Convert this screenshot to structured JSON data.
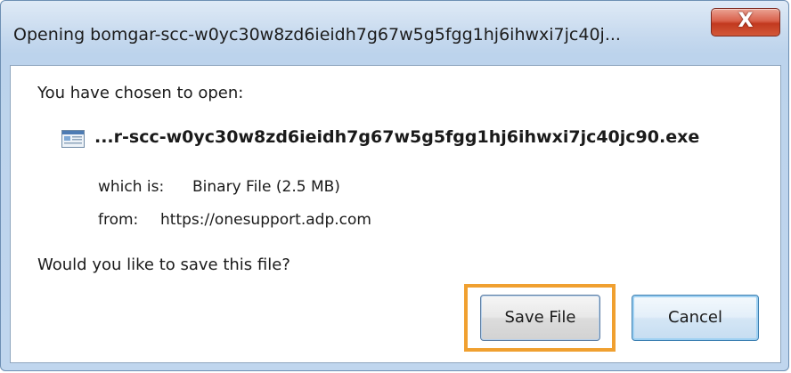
{
  "window": {
    "title": "Opening bomgar-scc-w0yc30w8zd6ieidh7g67w5g5fgg1hj6ihwxi7jc40j...",
    "close_glyph": "X"
  },
  "dialog": {
    "prompt": "You have chosen to open:",
    "file_icon": "exe-file-icon",
    "file_name": "...r-scc-w0yc30w8zd6ieidh7g67w5g5fgg1hj6ihwxi7jc40jc90.exe",
    "which_is_label": "which is:",
    "which_is_value": "Binary File (2.5 MB)",
    "from_label": "from:",
    "from_value": "https://onesupport.adp.com",
    "question": "Would you like to save this file?"
  },
  "buttons": {
    "save_label": "Save File",
    "cancel_label": "Cancel"
  },
  "colors": {
    "highlight": "#f0a030",
    "close_button": "#c2391f",
    "title_bar": "#c6d9ee"
  }
}
